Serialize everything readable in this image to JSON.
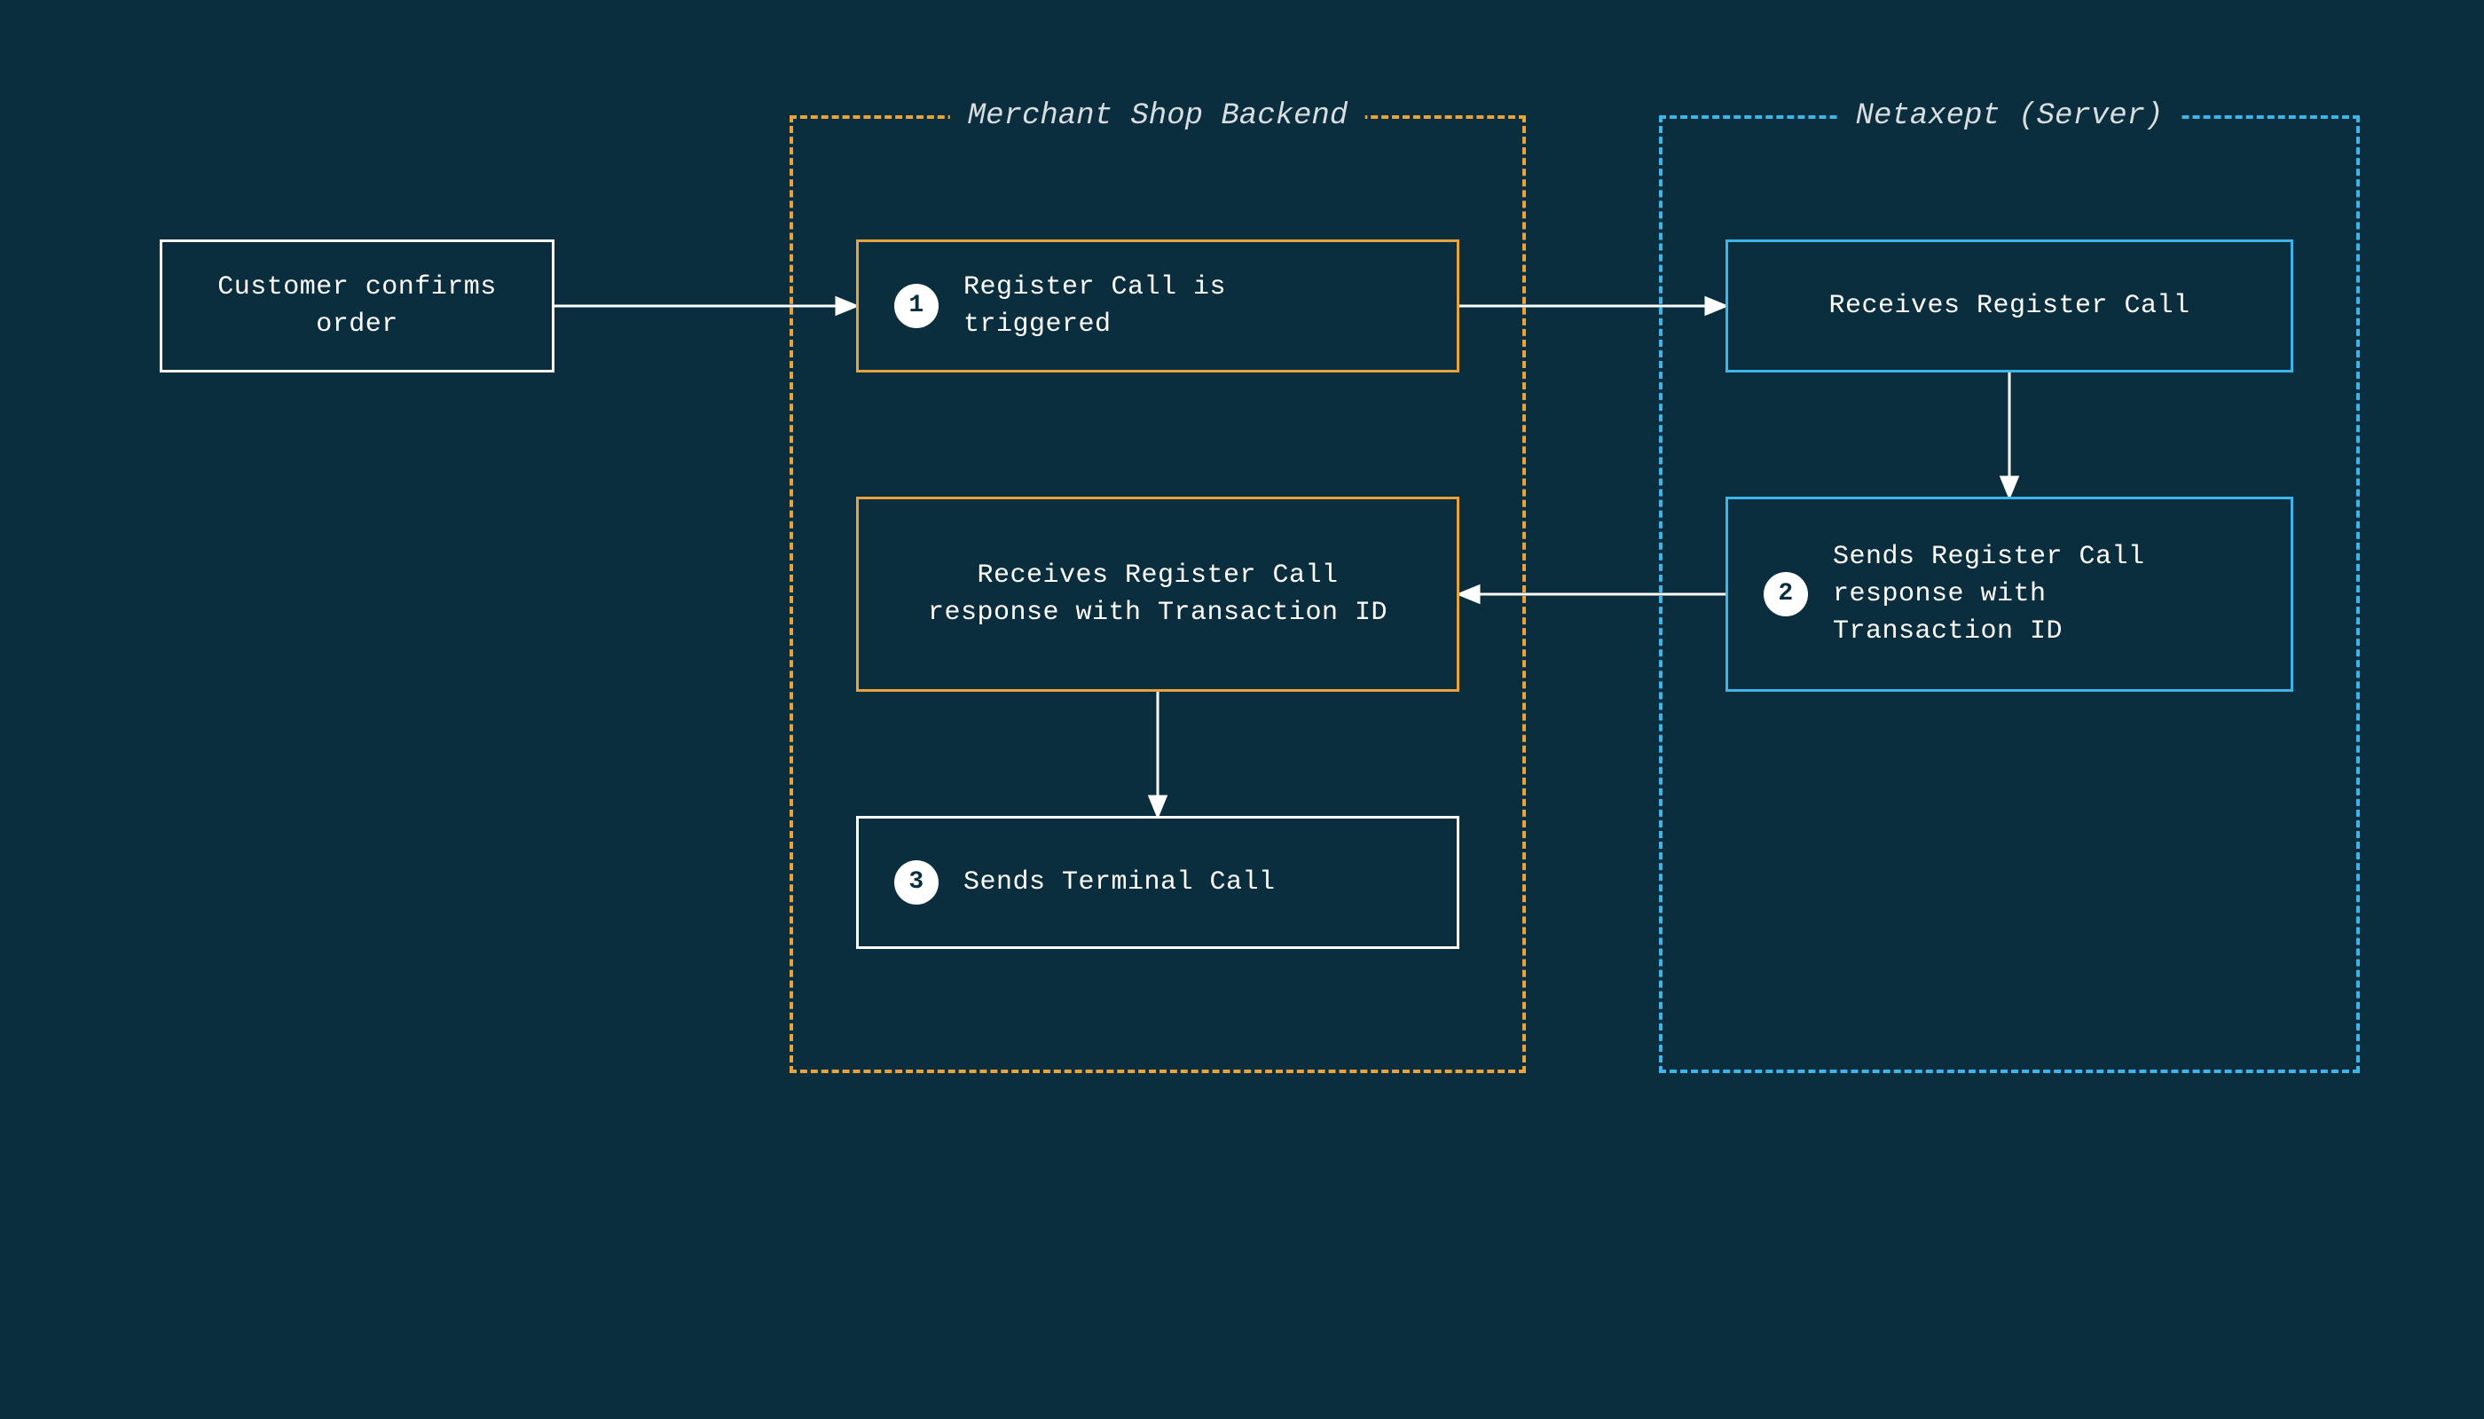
{
  "containers": {
    "merchant": {
      "label": "Merchant Shop Backend"
    },
    "netaxept": {
      "label": "Netaxept (Server)"
    }
  },
  "boxes": {
    "customer": {
      "text": "Customer confirms order"
    },
    "register_call": {
      "badge": "1",
      "text": "Register Call is triggered"
    },
    "receives_register": {
      "text": "Receives Register Call"
    },
    "sends_register_response": {
      "badge": "2",
      "text": "Sends Register Call response with Transaction ID"
    },
    "receives_register_response": {
      "text": "Receives Register Call response with Transaction ID"
    },
    "sends_terminal": {
      "badge": "3",
      "text": "Sends Terminal Call"
    }
  },
  "diagram_flow": [
    {
      "from": "customer",
      "to": "register_call",
      "direction": "right"
    },
    {
      "from": "register_call",
      "to": "receives_register",
      "direction": "right"
    },
    {
      "from": "receives_register",
      "to": "sends_register_response",
      "direction": "down"
    },
    {
      "from": "sends_register_response",
      "to": "receives_register_response",
      "direction": "left"
    },
    {
      "from": "receives_register_response",
      "to": "sends_terminal",
      "direction": "down"
    }
  ]
}
